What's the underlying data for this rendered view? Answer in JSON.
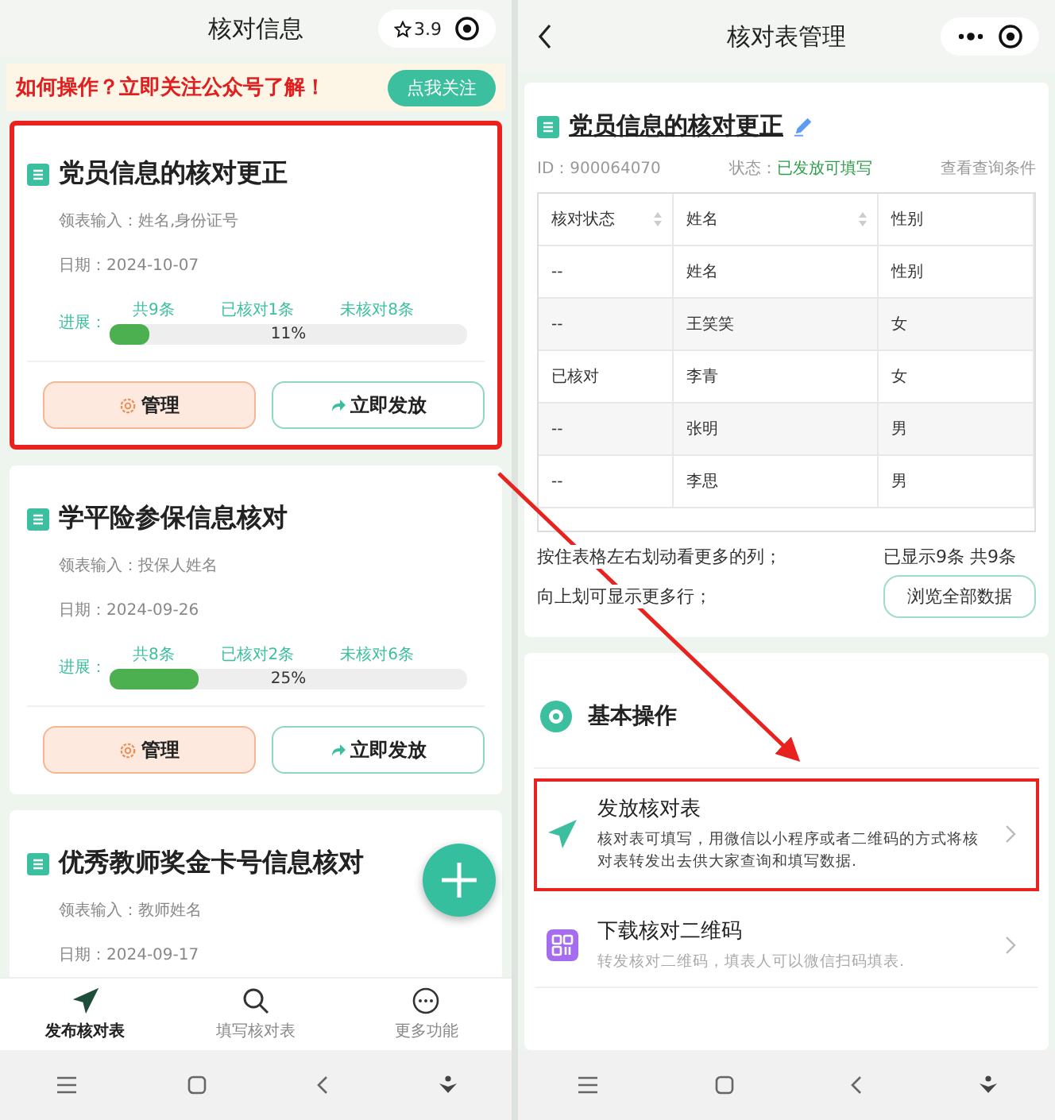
{
  "left": {
    "header": {
      "title": "核对信息",
      "rating": "3.9"
    },
    "banner": {
      "text": "如何操作？立即关注公众号了解！",
      "button": "点我关注"
    },
    "cards": [
      {
        "title": "党员信息的核对更正",
        "input": "领表输入：姓名,身份证号",
        "date": "日期：2024-10-07",
        "highlighted": true,
        "progress": {
          "label": "进展：",
          "total": "共9条",
          "checked": "已核对1条",
          "unchecked": "未核对8条",
          "level": 0.11,
          "percent": "11%"
        },
        "buttons": [
          "管理",
          "立即发放"
        ]
      },
      {
        "title": "学平险参保信息核对",
        "input": "领表输入：投保人姓名",
        "date": "日期：2024-09-26",
        "highlighted": false,
        "progress": {
          "label": "进展：",
          "total": "共8条",
          "checked": "已核对2条",
          "unchecked": "未核对6条",
          "level": 0.25,
          "percent": "25%"
        },
        "buttons": [
          "管理",
          "立即发放"
        ]
      },
      {
        "title": "优秀教师奖金卡号信息核对",
        "input": "领表输入：教师姓名",
        "date": "日期：2024-09-17",
        "highlighted": false
      }
    ],
    "tabs": [
      {
        "kind": "send",
        "label": "发布核对表",
        "selected": true
      },
      {
        "kind": "search",
        "label": "填写核对表",
        "selected": false
      },
      {
        "kind": "more",
        "label": "更多功能",
        "selected": false
      }
    ]
  },
  "right": {
    "header": {
      "title": "核对表管理"
    },
    "title": "党员信息的核对更正",
    "id": "ID：900064070",
    "status_label": "状态：",
    "status": "已发放可填写",
    "query_link": "查看查询条件",
    "table": {
      "columns": [
        {
          "label": "核对状态",
          "sortable": true
        },
        {
          "label": "姓名",
          "sortable": true
        },
        {
          "label": "性别",
          "sortable": false
        }
      ],
      "rows": [
        [
          "--",
          "姓名",
          "性别"
        ],
        [
          "--",
          "王笑笑",
          "女"
        ],
        [
          "已核对",
          "李青",
          "女"
        ],
        [
          "--",
          "张明",
          "男"
        ],
        [
          "--",
          "李思",
          "男"
        ]
      ]
    },
    "hints": [
      "按住表格左右划动看更多的列；",
      "向上划可显示更多行；"
    ],
    "count": "已显示9条 共9条",
    "browse_button": "浏览全部数据",
    "section": {
      "title": "基本操作",
      "actions": [
        {
          "kind": "send",
          "title": "发放核对表",
          "description": "核对表可填写，用微信以小程序或者二维码的方式将核对表转发出去供大家查询和填写数据.",
          "highlighted": true
        },
        {
          "kind": "qr",
          "title": "下载核对二维码",
          "description": "转发核对二维码，填表人可以微信扫码填表.",
          "highlighted": false
        }
      ]
    }
  }
}
